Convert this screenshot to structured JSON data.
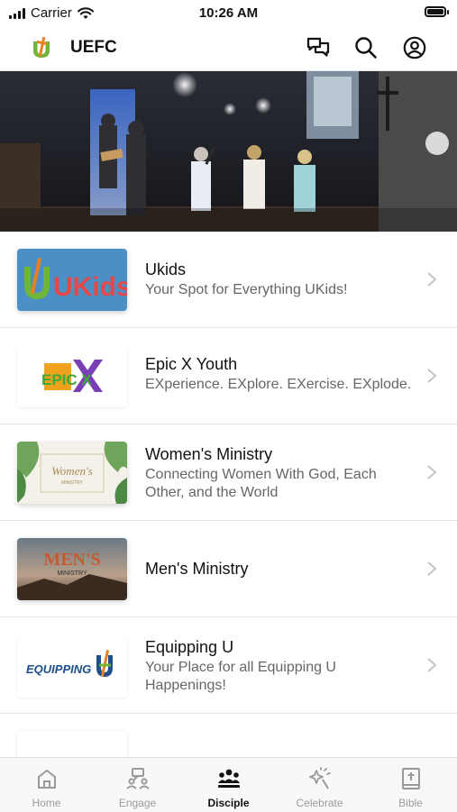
{
  "status": {
    "carrier": "Carrier",
    "time": "10:26 AM"
  },
  "header": {
    "title": "UEFC",
    "icons": [
      "messages-icon",
      "search-icon",
      "profile-icon"
    ]
  },
  "list": [
    {
      "title": "Ukids",
      "subtitle": "Your Spot for Everything UKids!",
      "thumb_text": "UKids"
    },
    {
      "title": "Epic X Youth",
      "subtitle": "EXperience. EXplore. EXercise. EXplode.",
      "thumb_text": "EPIC X"
    },
    {
      "title": "Women's Ministry",
      "subtitle": "Connecting Women With God, Each Other, and the World",
      "thumb_text": "Women's",
      "thumb_text2": "MINISTRY"
    },
    {
      "title": "Men's Ministry",
      "subtitle": "",
      "thumb_text": "MEN'S",
      "thumb_text2": "MINISTRY"
    },
    {
      "title": "Equipping U",
      "subtitle": "Your Place for all Equipping U Happenings!",
      "thumb_text": "EQUIPPING"
    }
  ],
  "tabs": [
    {
      "label": "Home",
      "icon": "home-icon"
    },
    {
      "label": "Engage",
      "icon": "engage-icon"
    },
    {
      "label": "Disciple",
      "icon": "disciple-icon",
      "active": true
    },
    {
      "label": "Celebrate",
      "icon": "celebrate-icon"
    },
    {
      "label": "Bible",
      "icon": "bible-icon"
    }
  ],
  "colors": {
    "accent": "#111111",
    "inactive": "#9a9a9a",
    "logo_green": "#6fb53b",
    "logo_orange": "#e8801f"
  }
}
